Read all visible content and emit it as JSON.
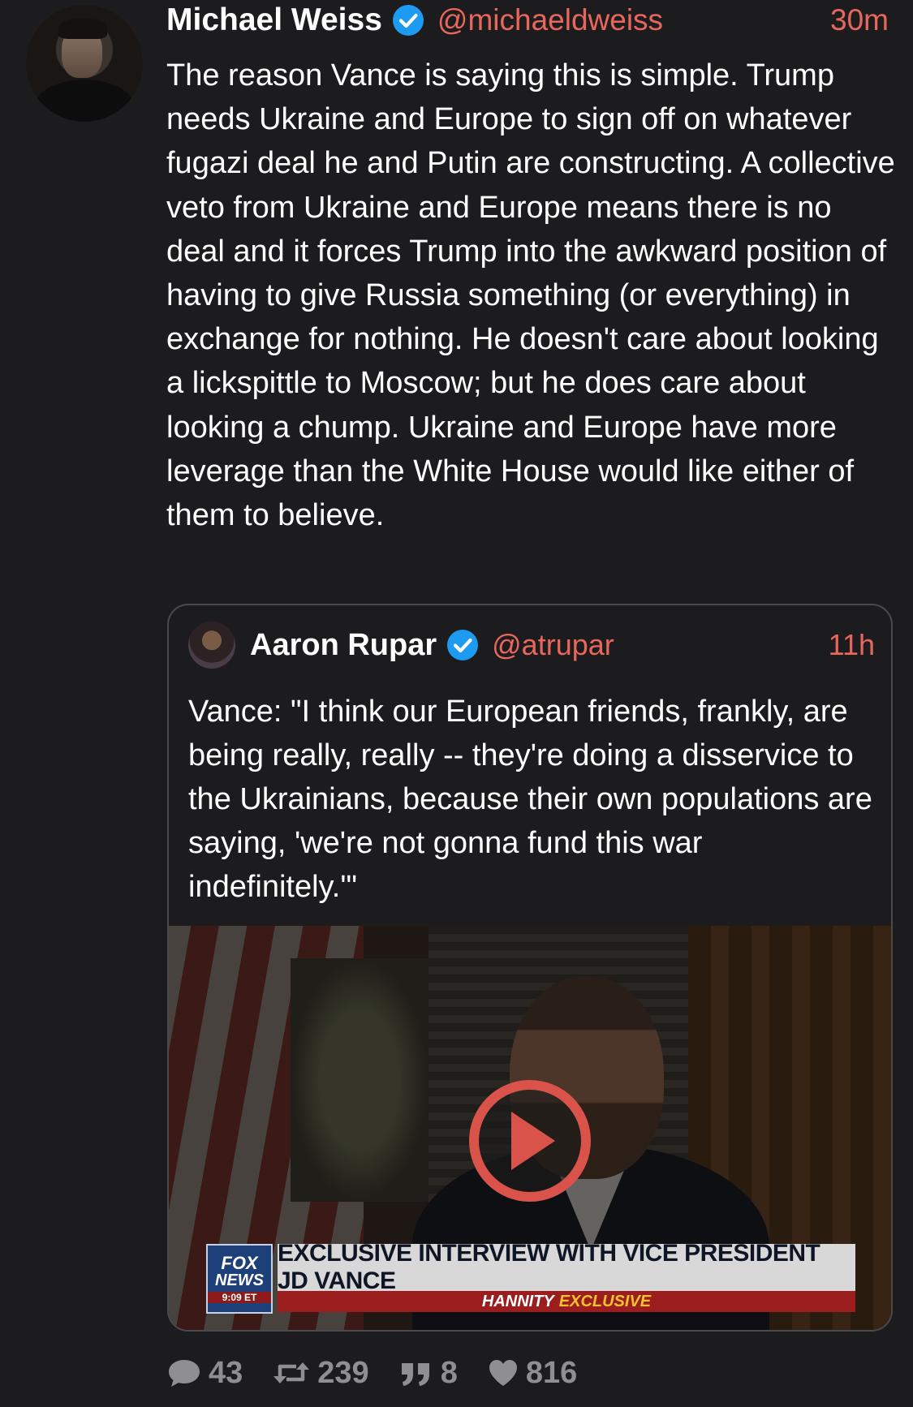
{
  "tweet": {
    "author_name": "Michael Weiss",
    "author_handle": "@michaeldweiss",
    "time": "30m",
    "text": "The reason Vance is saying this is simple. Trump needs Ukraine and Europe to sign off on whatever fugazi deal he and Putin are constructing. A collective veto from Ukraine and Europe means there is no deal and it forces Trump into the awkward position of having to give Russia something (or everything) in exchange for nothing. He doesn't care about looking a lickspittle to Moscow; but he does care about looking a chump. Ukraine and Europe have more leverage than the White House would like either of them to believe."
  },
  "quote": {
    "author_name": "Aaron Rupar",
    "author_handle": "@atrupar",
    "time": "11h",
    "text": "Vance: \"I think our European friends, frankly, are being really, really -- they're doing a disservice to the Ukrainians, because their own populations are saying, 'we're not gonna fund this war indefinitely.'\"",
    "video": {
      "play_icon": "play-icon",
      "chyron": {
        "logo_line1": "FOX",
        "logo_line2": "NEWS",
        "logo_time": "9:09 ET",
        "headline": "EXCLUSIVE INTERVIEW WITH VICE PRESIDENT JD VANCE",
        "sub_label": "HANNITY",
        "sub_highlight": "EXCLUSIVE"
      }
    }
  },
  "actions": {
    "replies": "43",
    "retweets": "239",
    "quotes": "8",
    "likes": "816"
  },
  "colors": {
    "background": "#1c1c1e",
    "accent": "#e8675c",
    "verified": "#1d9bf0",
    "muted": "#8e8e93"
  }
}
